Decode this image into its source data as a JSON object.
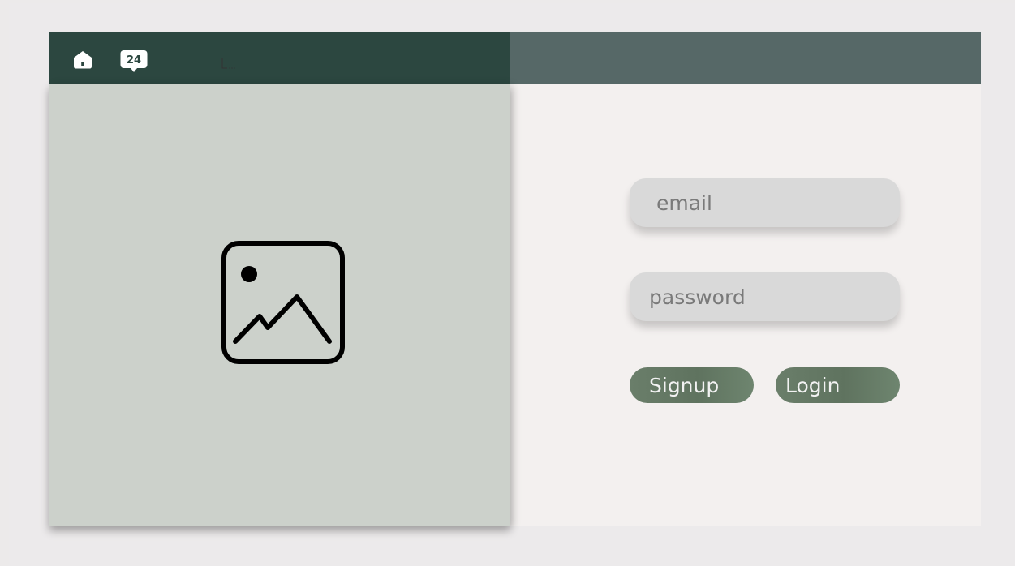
{
  "form": {
    "email_placeholder": "email",
    "password_placeholder": "password",
    "signup_label": "Signup",
    "login_label": "Login"
  },
  "header": {
    "calendar_day": "24",
    "icons": [
      "home-icon",
      "calendar-icon"
    ]
  },
  "media": {
    "icon": "image-placeholder-icon"
  },
  "colors": {
    "topbar_left": "#2C4740",
    "topbar_right": "#566867",
    "left_panel": "#CCD1CB",
    "content_bg": "#F3F0EF",
    "input_bg": "#D9D9D9",
    "button": "#647964",
    "button_text": "#F2F2F2"
  }
}
